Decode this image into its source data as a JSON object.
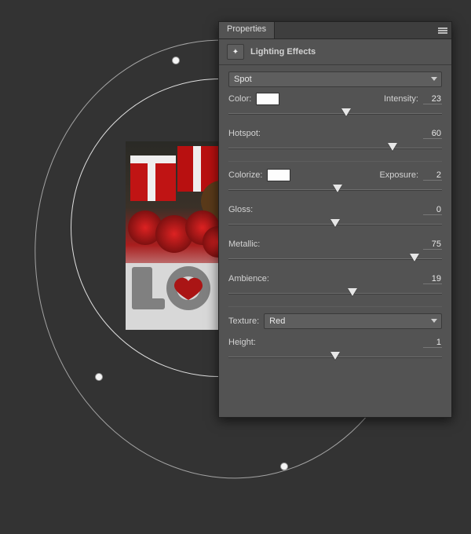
{
  "panel": {
    "tab": "Properties",
    "title": "Lighting Effects",
    "light_type": "Spot",
    "texture": "Red",
    "labels": {
      "color": "Color:",
      "intensity": "Intensity:",
      "hotspot": "Hotspot:",
      "colorize": "Colorize:",
      "exposure": "Exposure:",
      "gloss": "Gloss:",
      "metallic": "Metallic:",
      "ambience": "Ambience:",
      "texture": "Texture:",
      "height": "Height:"
    },
    "values": {
      "intensity": "23",
      "hotspot": "60",
      "exposure": "2",
      "gloss": "0",
      "metallic": "75",
      "ambience": "19",
      "height": "1"
    },
    "slider_percent": {
      "intensity": 55,
      "hotspot": 77,
      "exposure": 51,
      "gloss": 50,
      "metallic": 87,
      "ambience": 58,
      "height": 50
    },
    "swatches": {
      "color": "#fdfdfd",
      "colorize": "#fdfdfd"
    }
  }
}
